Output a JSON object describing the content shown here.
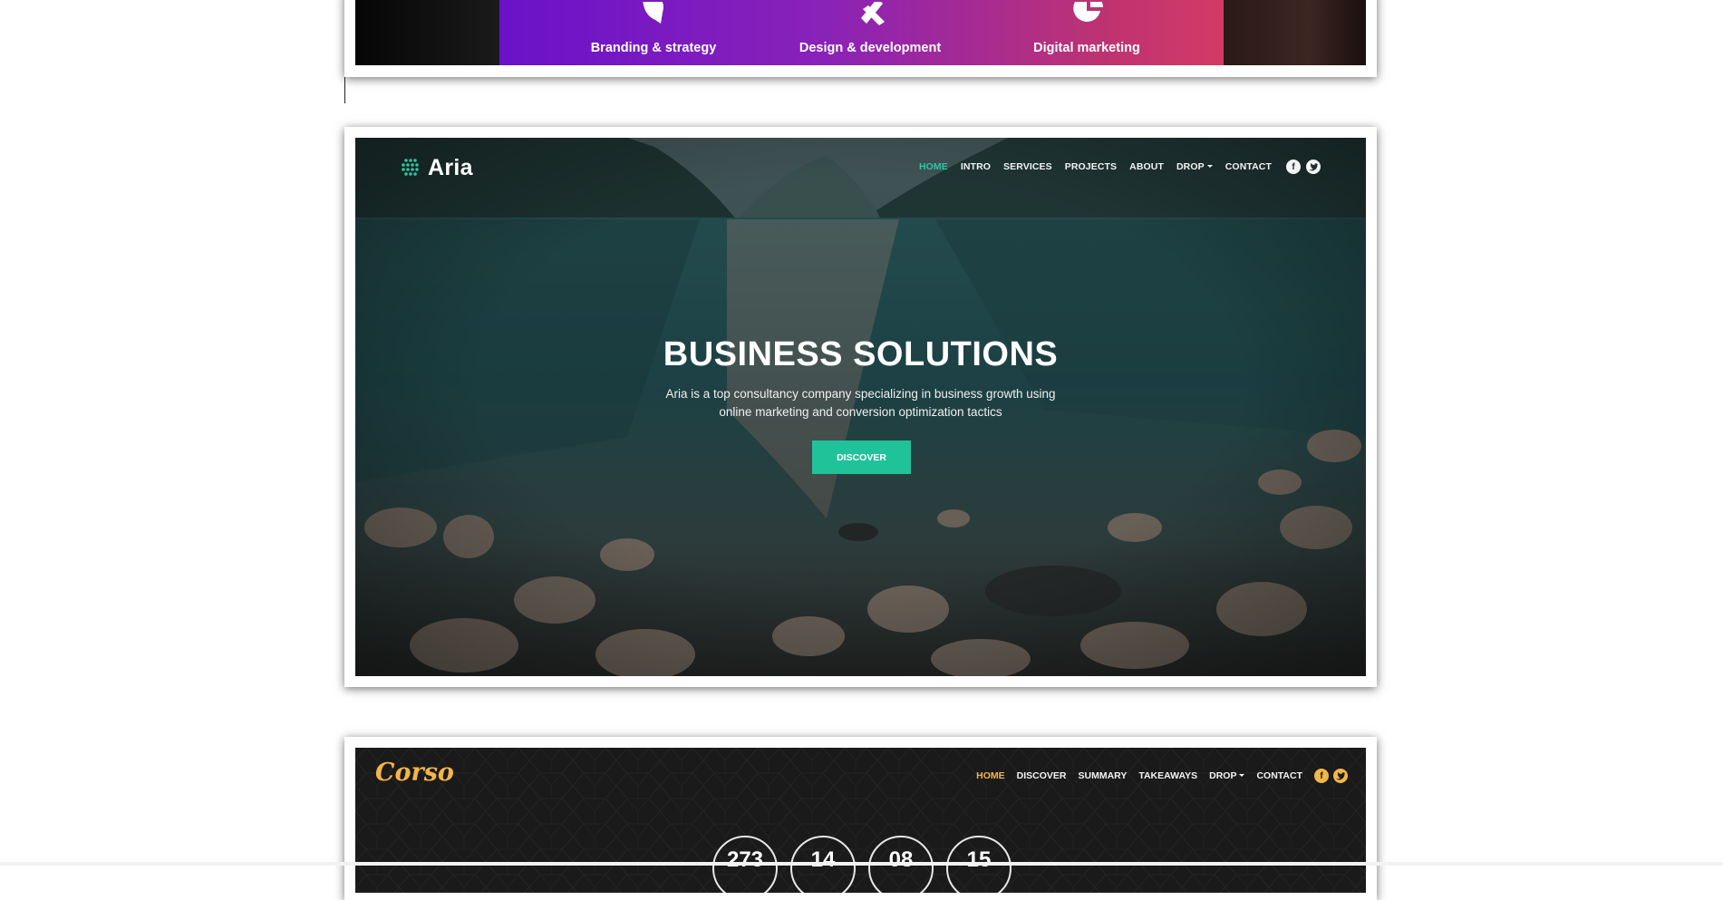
{
  "card1": {
    "services": [
      {
        "label": "Branding & strategy",
        "icon": "head-icon"
      },
      {
        "label": "Design & development",
        "icon": "pencil-ruler-icon"
      },
      {
        "label": "Digital marketing",
        "icon": "pie-chart-icon"
      }
    ],
    "gradient": [
      "#6a12c9",
      "#d33b66"
    ]
  },
  "aria": {
    "logo_text": "Aria",
    "nav": [
      "HOME",
      "INTRO",
      "SERVICES",
      "PROJECTS",
      "ABOUT",
      "DROP",
      "CONTACT"
    ],
    "social": [
      "facebook-icon",
      "twitter-icon"
    ],
    "title": "BUSINESS SOLUTIONS",
    "subtitle_line1": "Aria is a top consultancy company specializing in business growth using",
    "subtitle_line2": "online marketing and conversion optimization tactics",
    "cta": "DISCOVER",
    "accent": "#20c29a"
  },
  "corso": {
    "logo_text": "Corso",
    "nav": [
      "HOME",
      "DISCOVER",
      "SUMMARY",
      "TAKEAWAYS",
      "DROP",
      "CONTACT"
    ],
    "social": [
      "facebook-icon",
      "twitter-icon"
    ],
    "countdown": [
      "273",
      "14",
      "08",
      "15"
    ],
    "accent": "#f2b54a"
  }
}
